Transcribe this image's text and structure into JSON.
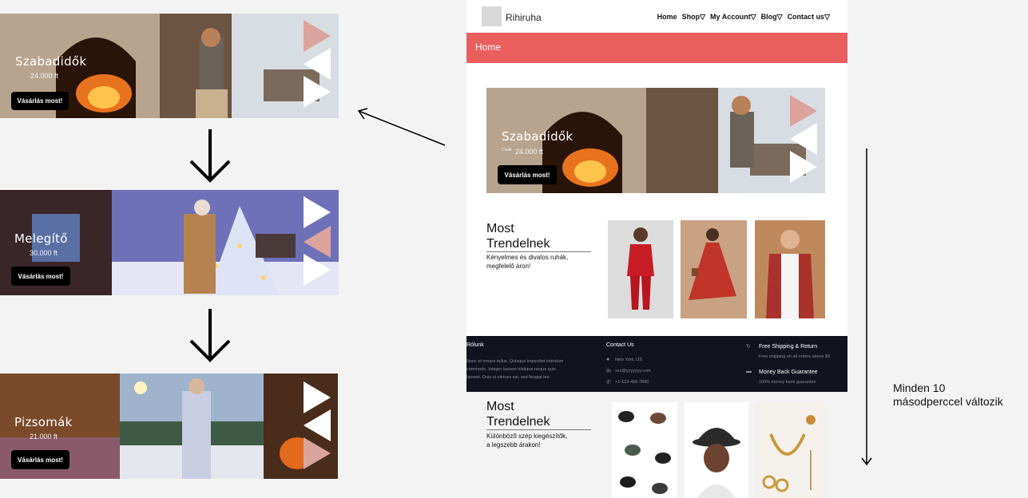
{
  "left_banners": [
    {
      "title": "Szabadidők",
      "price": "24.000 ft",
      "button": "Vásárlás most!"
    },
    {
      "title": "Melegítő",
      "price": "30.000 ft",
      "button": "Vásárlás most!"
    },
    {
      "title": "Pizsomák",
      "price": "21.000 ft",
      "button": "Vásárlás most!"
    }
  ],
  "site": {
    "brand": "Rihiruha",
    "nav": [
      "Home",
      "Shop▽",
      "My Account▽",
      "Blog▽",
      "Contact us▽"
    ],
    "home_bar": "Home",
    "hero": {
      "title": "Szabadidők",
      "price_prefix": "Csak",
      "price": "24.000 ft",
      "button": "Vásárlás most!"
    },
    "trend1": {
      "title_line1": "Most",
      "title_line2": "Trendelnek",
      "sub_line1": "Kényelmes és divatos ruhák,",
      "sub_line2": "megfelelő áron!"
    },
    "footer": {
      "about_title": "Rólunk",
      "about_lines": [
        "Nunc et ornare tellus. Quisque imperdiet interdum",
        "commodo. Integer laoreet tristique neque quis",
        "laoreet. Duis ut ultrices est, sed feugiat leo"
      ],
      "contact_title": "Contact Us",
      "contact_lines": [
        "New York, US",
        "xxx@yyyyyyy.com",
        "+1-123-456-7890"
      ],
      "shipping_title": "Free Shipping & Return",
      "shipping_text": "Free shipping on all orders above $9",
      "money_title": "Money Back Guarantee",
      "money_text": "100% money back guarantee"
    }
  },
  "trend2": {
    "title_line1": "Most",
    "title_line2": "Trendelnek",
    "sub_line1": "Különböző szép kiegészítők,",
    "sub_line2": "a legszebb árakon!"
  },
  "caption": {
    "line1": "Minden 10",
    "line2": "másodperccel változik"
  },
  "colors": {
    "accent": "#ea5e5e",
    "pink_arrow": "#dba39d",
    "footer_bg": "#12131f"
  }
}
